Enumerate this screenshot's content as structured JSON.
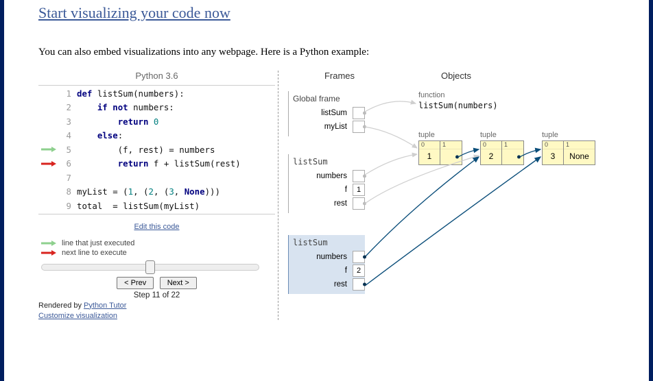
{
  "header_link": "Start visualizing your code now",
  "intro_text": "You can also embed visualizations into any webpage. Here is a Python example:",
  "language_label": "Python 3.6",
  "code_lines": [
    "def listSum(numbers):",
    "    if not numbers:",
    "        return 0",
    "    else:",
    "        (f, rest) = numbers",
    "        return f + listSum(rest)",
    "",
    "myList = (1, (2, (3, None)))",
    "total  = listSum(myList)"
  ],
  "arrows": {
    "just_executed_line": 5,
    "next_line": 6
  },
  "edit_link": "Edit this code",
  "legend": {
    "just_executed": "line that just executed",
    "next": "next line to execute"
  },
  "buttons": {
    "prev": "< Prev",
    "next": "Next >"
  },
  "step_label": "Step 11 of 22",
  "rendered_by_prefix": "Rendered by ",
  "rendered_by_link": "Python Tutor",
  "customize_link": "Customize visualization",
  "right": {
    "frames_header": "Frames",
    "objects_header": "Objects",
    "global_frame_title": "Global frame",
    "global_vars": [
      "listSum",
      "myList"
    ],
    "call1_title": "listSum",
    "call1_vars": {
      "numbers": "numbers",
      "f": "f",
      "fval": "1",
      "rest": "rest"
    },
    "call2_title": "listSum",
    "call2_vars": {
      "numbers": "numbers",
      "f": "f",
      "fval": "2",
      "rest": "rest"
    },
    "objects": {
      "function_label": "function",
      "function_sig": "listSum(numbers)",
      "tuple_label": "tuple",
      "tuples": [
        {
          "idx": [
            "0",
            "1"
          ],
          "vals": [
            "1",
            null
          ]
        },
        {
          "idx": [
            "0",
            "1"
          ],
          "vals": [
            "2",
            null
          ]
        },
        {
          "idx": [
            "0",
            "1"
          ],
          "vals": [
            "3",
            "None"
          ]
        }
      ]
    }
  }
}
